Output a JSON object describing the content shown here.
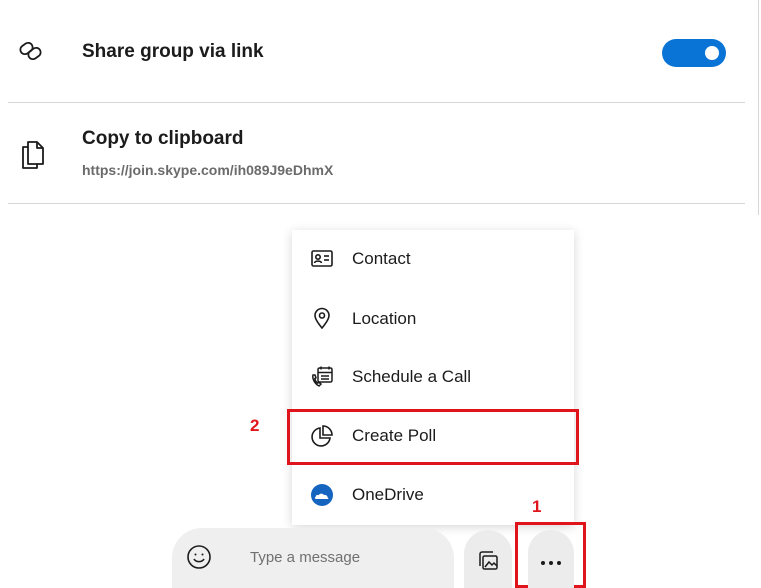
{
  "share_link": {
    "label": "Share group via link",
    "enabled": true,
    "toggle_color": "#0a74d6",
    "icon": "link-icon"
  },
  "copy_clipboard": {
    "label": "Copy to clipboard",
    "url": "https://join.skype.com/ih089J9eDhmX",
    "icon": "copy-icon"
  },
  "menu": {
    "items": [
      {
        "label": "Contact",
        "icon": "contact-card-icon"
      },
      {
        "label": "Location",
        "icon": "location-pin-icon"
      },
      {
        "label": "Schedule a Call",
        "icon": "schedule-call-icon"
      },
      {
        "label": "Create Poll",
        "icon": "poll-icon"
      },
      {
        "label": "OneDrive",
        "icon": "onedrive-icon"
      }
    ]
  },
  "composer": {
    "placeholder": "Type a message",
    "emoji_icon": "emoji-icon",
    "media_icon": "media-gallery-icon",
    "more_icon": "more-options-icon"
  },
  "annotations": {
    "step1": "1",
    "step2": "2",
    "color": "#e0151b"
  }
}
